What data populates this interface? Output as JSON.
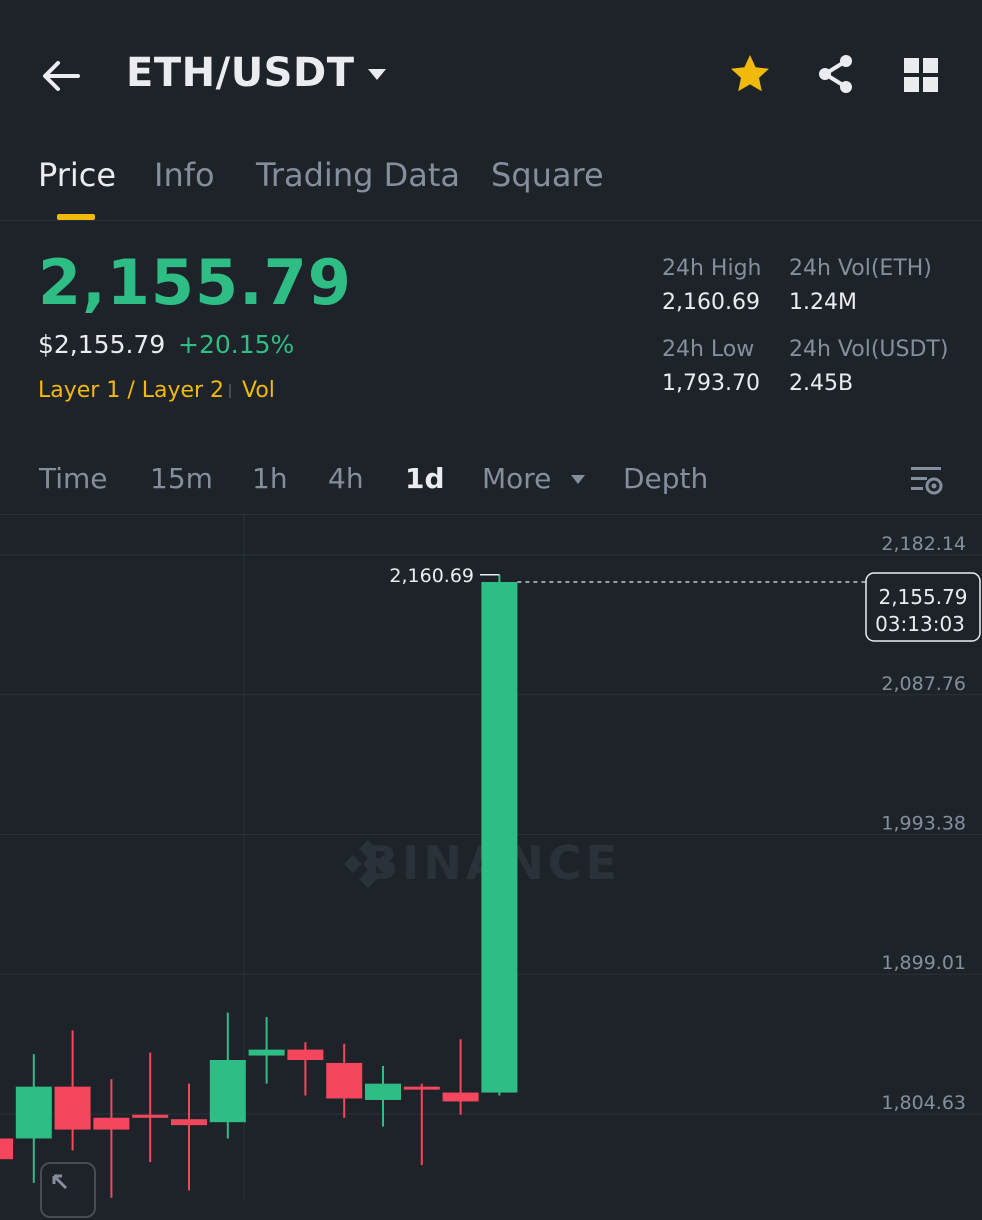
{
  "header": {
    "pair": "ETH/USDT",
    "icons": [
      "back-arrow-icon",
      "caret-down-icon",
      "star-icon",
      "share-icon",
      "grid-icon"
    ],
    "star_color": "#f0b90b"
  },
  "tabs": [
    {
      "label": "Price",
      "active": true
    },
    {
      "label": "Info",
      "active": false
    },
    {
      "label": "Trading Data",
      "active": false
    },
    {
      "label": "Square",
      "active": false
    }
  ],
  "ticker": {
    "last_price": "2,155.79",
    "usd_price": "$2,155.79",
    "change": "+20.15%",
    "tag_category": "Layer 1 / Layer 2",
    "tag_vol": "Vol",
    "stats": {
      "high_label": "24h High",
      "high_value": "2,160.69",
      "vol_eth_label": "24h Vol(ETH)",
      "vol_eth_value": "1.24M",
      "low_label": "24h Low",
      "low_value": "1,793.70",
      "vol_usdt_label": "24h Vol(USDT)",
      "vol_usdt_value": "2.45B"
    }
  },
  "intervals": {
    "time": "Time",
    "m15": "15m",
    "h1": "1h",
    "h4": "4h",
    "d1": "1d",
    "more": "More",
    "depth": "Depth",
    "active": "1d"
  },
  "colors": {
    "up": "#2ebd85",
    "down": "#f6465d",
    "accent": "#f0b90b",
    "bg": "#1e2329"
  },
  "chart_data": {
    "type": "candlestick",
    "watermark": "BINANCE",
    "y_ticks": [
      "2,182.14",
      "2,087.76",
      "1,993.38",
      "1,899.01",
      "1,804.63"
    ],
    "y_tick_values": [
      2182.14,
      2087.76,
      1993.38,
      1899.01,
      1804.63
    ],
    "ylim": [
      1766,
      2210
    ],
    "high_marker": "2,160.69",
    "current_price_label": "2,155.79",
    "countdown": "03:13:03",
    "current_price": 2155.79,
    "candles": [
      {
        "o": 1780,
        "h": 1820,
        "l": 1740,
        "c": 1766
      },
      {
        "o": 1780,
        "h": 1837,
        "l": 1750,
        "c": 1815
      },
      {
        "o": 1815,
        "h": 1853,
        "l": 1772,
        "c": 1786
      },
      {
        "o": 1794,
        "h": 1820,
        "l": 1740,
        "c": 1786
      },
      {
        "o": 1796,
        "h": 1838,
        "l": 1764,
        "c": 1794
      },
      {
        "o": 1793,
        "h": 1817,
        "l": 1745,
        "c": 1789
      },
      {
        "o": 1791,
        "h": 1865,
        "l": 1780,
        "c": 1833
      },
      {
        "o": 1836,
        "h": 1862,
        "l": 1817,
        "c": 1840
      },
      {
        "o": 1840,
        "h": 1845,
        "l": 1809,
        "c": 1833
      },
      {
        "o": 1831,
        "h": 1844,
        "l": 1794,
        "c": 1807
      },
      {
        "o": 1806,
        "h": 1829,
        "l": 1788,
        "c": 1817
      },
      {
        "o": 1815,
        "h": 1817,
        "l": 1762,
        "c": 1813
      },
      {
        "o": 1811,
        "h": 1847,
        "l": 1796,
        "c": 1805
      },
      {
        "o": 1811,
        "h": 2160.69,
        "l": 1809,
        "c": 2155.79
      }
    ]
  }
}
